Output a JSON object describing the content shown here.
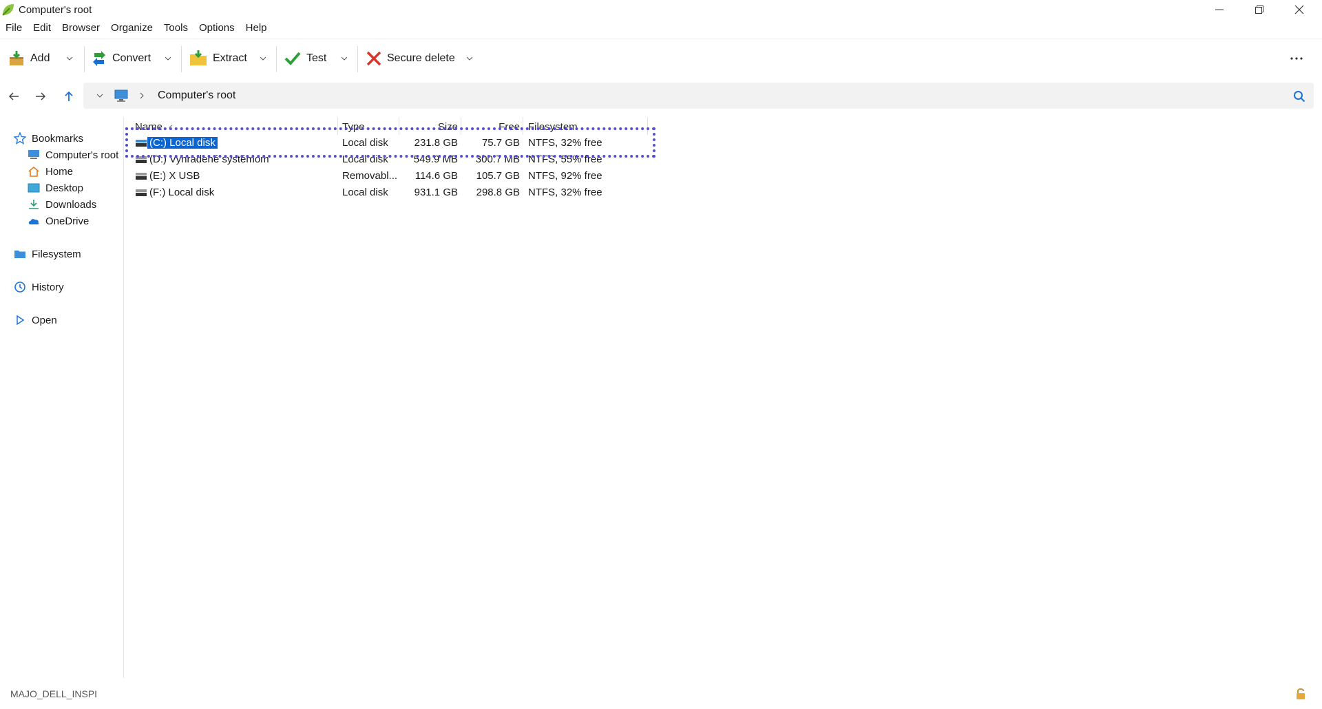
{
  "window": {
    "title": "Computer's root"
  },
  "menu": [
    "File",
    "Edit",
    "Browser",
    "Organize",
    "Tools",
    "Options",
    "Help"
  ],
  "toolbar": {
    "add": "Add",
    "convert": "Convert",
    "extract": "Extract",
    "test": "Test",
    "secure_delete": "Secure delete"
  },
  "address": {
    "path": "Computer's root"
  },
  "sidebar": {
    "bookmarks": "Bookmarks",
    "bookmark_items": [
      "Computer's root",
      "Home",
      "Desktop",
      "Downloads",
      "OneDrive"
    ],
    "filesystem": "Filesystem",
    "history": "History",
    "open": "Open"
  },
  "columns": {
    "name": "Name",
    "type": "Type",
    "size": "Size",
    "free": "Free",
    "filesystem": "Filesystem"
  },
  "rows": [
    {
      "name": "(C:) Local disk",
      "type": "Local disk",
      "size": "231.8 GB",
      "free": "75.7 GB",
      "filesystem": "NTFS, 32% free"
    },
    {
      "name": "(D:) Vyhradené systémom",
      "type": "Local disk",
      "size": "549.9 MB",
      "free": "300.7 MB",
      "filesystem": "NTFS, 55% free"
    },
    {
      "name": "(E:) X USB",
      "type": "Removabl...",
      "size": "114.6 GB",
      "free": "105.7 GB",
      "filesystem": "NTFS, 92% free"
    },
    {
      "name": "(F:) Local disk",
      "type": "Local disk",
      "size": "931.1 GB",
      "free": "298.8 GB",
      "filesystem": "NTFS, 32% free"
    }
  ],
  "status": {
    "computer_name": "MAJO_DELL_INSPI"
  },
  "colors": {
    "selection": "#0a64d2",
    "focus_outline": "#5050d8",
    "accent_blue": "#1a73d9"
  }
}
